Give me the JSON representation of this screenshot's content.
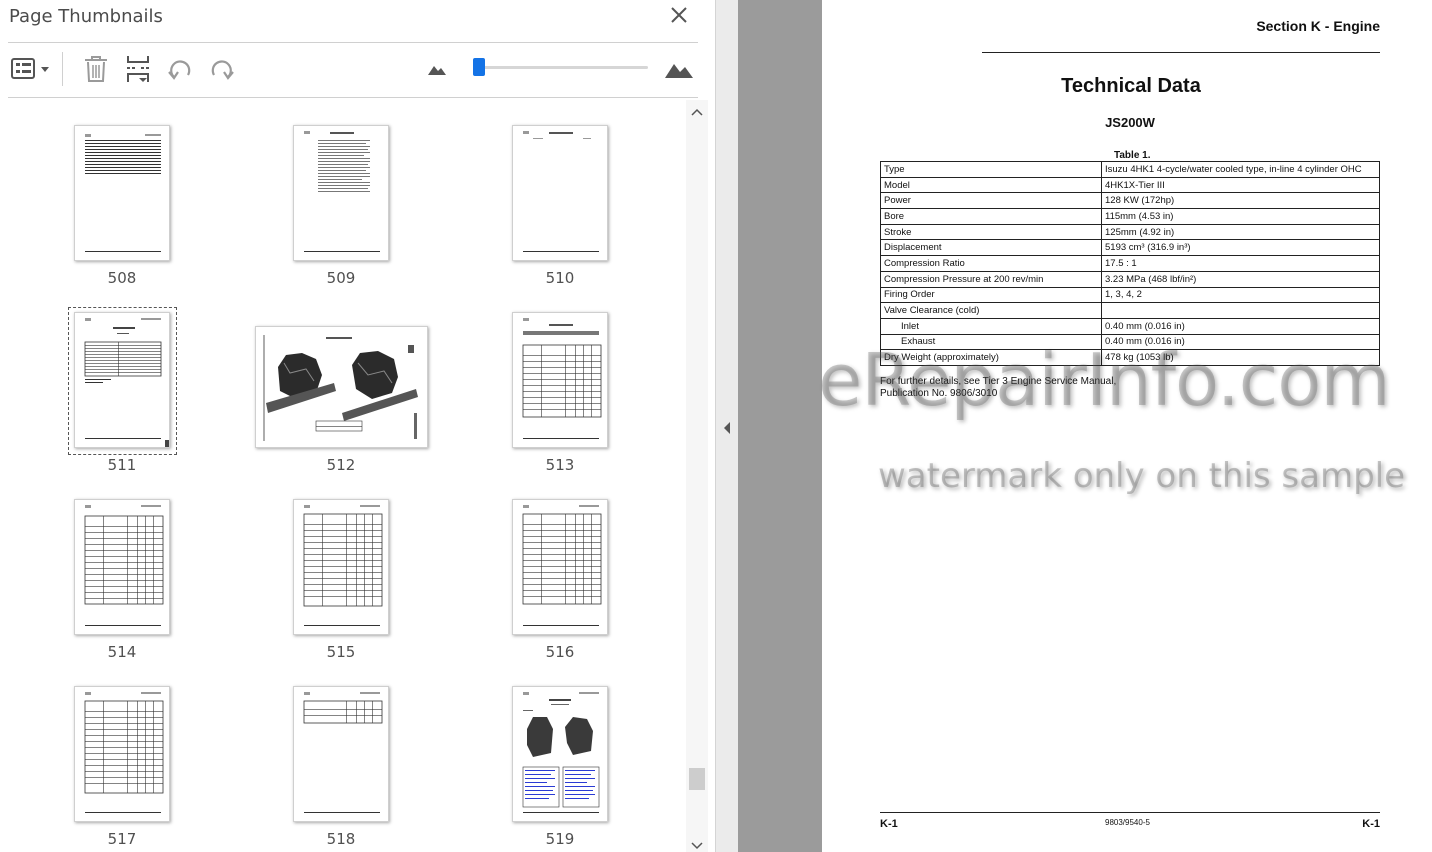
{
  "panel": {
    "title": "Page Thumbnails",
    "close_icon": "close-icon",
    "toolbar": {
      "options_icon": "thumbnail-options-icon",
      "delete_icon": "trash-icon",
      "insert_icon": "insert-page-icon",
      "rotate_ccw_icon": "rotate-counterclockwise-icon",
      "rotate_cw_icon": "rotate-clockwise-icon",
      "zoom_out_icon": "small-mountain-icon",
      "zoom_in_icon": "large-mountain-icon",
      "zoom_slider_level": 0.02
    }
  },
  "thumbnails": [
    {
      "page": "508"
    },
    {
      "page": "509"
    },
    {
      "page": "510"
    },
    {
      "page": "511",
      "selected": true
    },
    {
      "page": "512"
    },
    {
      "page": "513"
    },
    {
      "page": "514"
    },
    {
      "page": "515"
    },
    {
      "page": "516"
    },
    {
      "page": "517"
    },
    {
      "page": "518"
    },
    {
      "page": "519"
    }
  ],
  "document": {
    "header": "Section K - Engine",
    "title": "Technical Data",
    "subtitle": "JS200W",
    "table_caption": "Table 1.",
    "rows": [
      {
        "label": "Type",
        "value": "Isuzu 4HK1 4-cycle/water cooled type, in-line 4 cylinder OHC"
      },
      {
        "label": "Model",
        "value": "4HK1X-Tier III"
      },
      {
        "label": "Power",
        "value": "128 KW (172hp)"
      },
      {
        "label": "Bore",
        "value": "115mm (4.53 in)"
      },
      {
        "label": "Stroke",
        "value": "125mm (4.92 in)"
      },
      {
        "label": "Displacement",
        "value": "5193 cm³ (316.9 in³)"
      },
      {
        "label": "Compression Ratio",
        "value": "17.5 : 1"
      },
      {
        "label": "Compression Pressure at 200 rev/min",
        "value": "3.23 MPa (468 lbf/in²)"
      },
      {
        "label": "Firing Order",
        "value": "1, 3, 4, 2"
      },
      {
        "label": "Valve Clearance (cold)",
        "value": ""
      },
      {
        "label": "Inlet",
        "value": "0.40 mm (0.016 in)",
        "indent": true
      },
      {
        "label": "Exhaust",
        "value": "0.40 mm (0.016 in)",
        "indent": true
      },
      {
        "label": "Dry Weight (approximately)",
        "value": "478 kg (1053 lb)"
      }
    ],
    "note_line1": "For further details, see Tier 3 Engine Service Manual,",
    "note_line2": "Publication No. 9806/3010",
    "footer_left": "K-1",
    "footer_center": "9803/9540-5",
    "footer_right": "K-1"
  },
  "watermark": {
    "brand": "eRepairInfo.com",
    "caption": "watermark only on this sample"
  }
}
